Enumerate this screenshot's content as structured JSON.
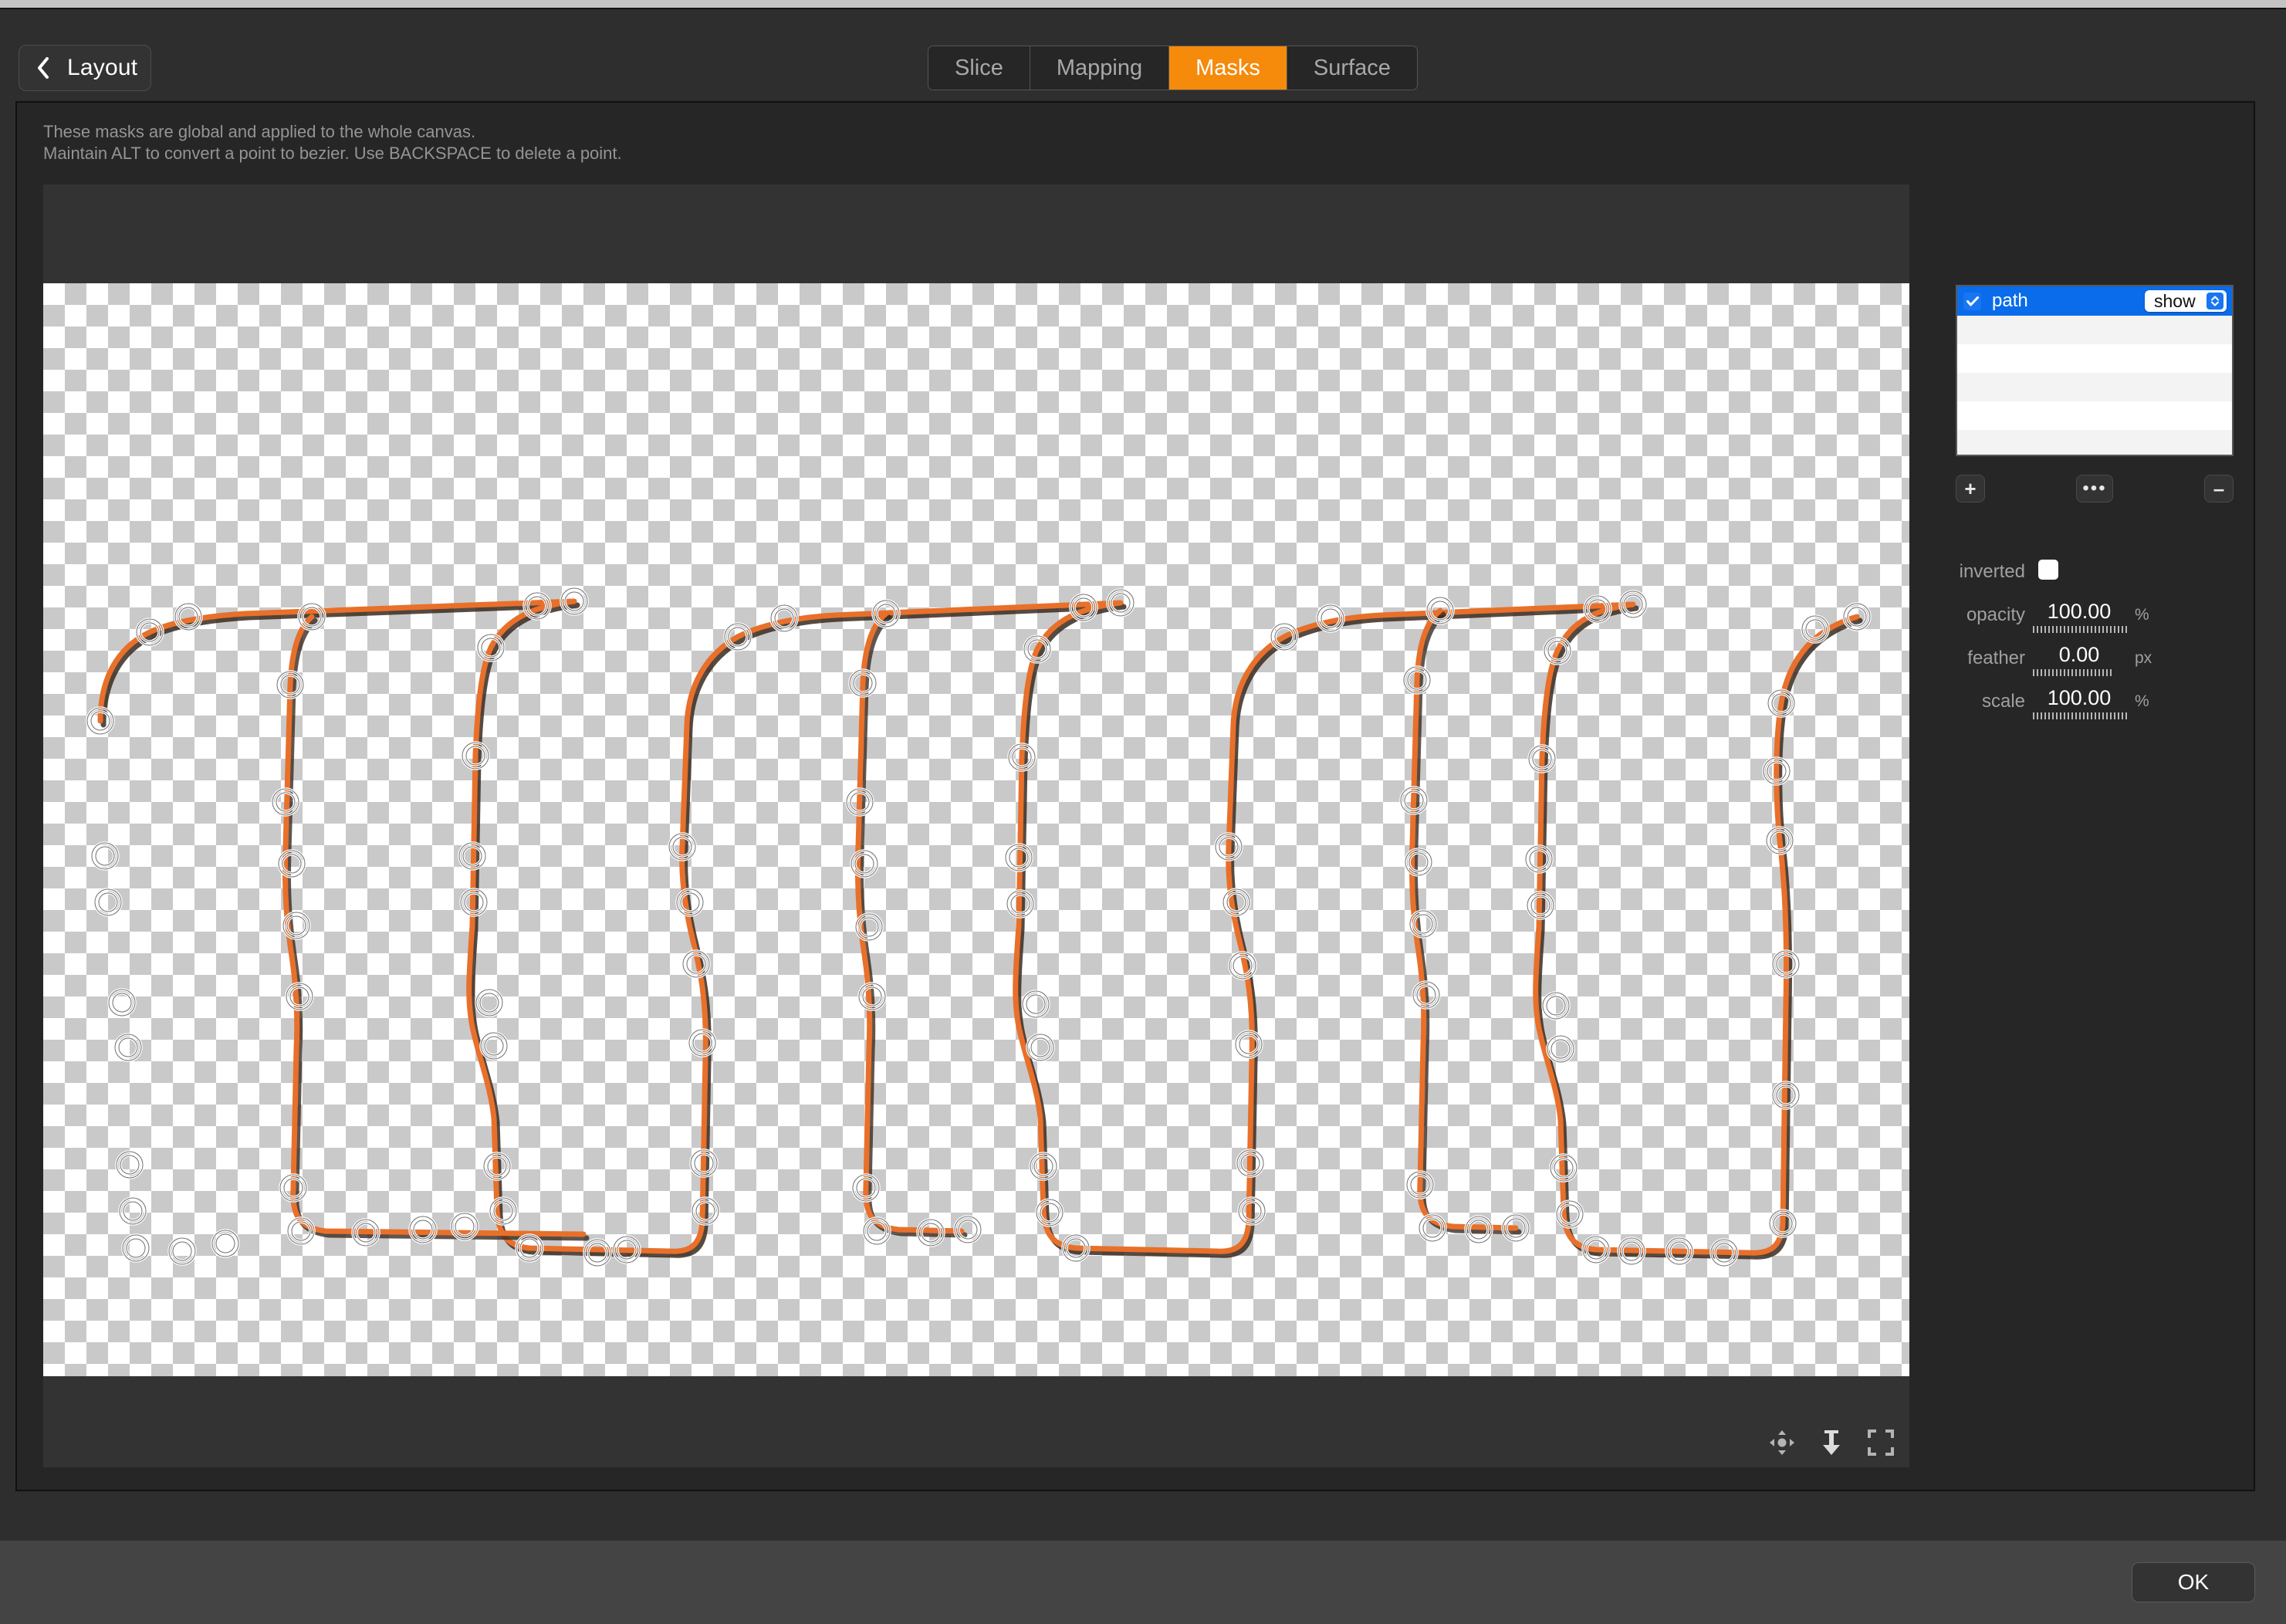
{
  "header": {
    "back_button": {
      "label": "Layout",
      "icon": "chevron-left-icon"
    },
    "tabs": [
      {
        "label": "Slice",
        "active": false
      },
      {
        "label": "Mapping",
        "active": false
      },
      {
        "label": "Masks",
        "active": true
      },
      {
        "label": "Surface",
        "active": false
      }
    ]
  },
  "main": {
    "hint_text": "These masks are global and applied to the whole canvas.\nMaintain ALT to convert a point to bezier. Use BACKSPACE to delete a point.",
    "canvas_tools": [
      {
        "name": "move-tool",
        "icon": "move-icon"
      },
      {
        "name": "fit-height-tool",
        "icon": "arrow-down-icon"
      },
      {
        "name": "fit-frame-tool",
        "icon": "fit-frame-icon"
      }
    ]
  },
  "sidebar": {
    "list": {
      "rows": [
        {
          "name": "path",
          "checked": true,
          "mode": "show",
          "selected": true
        },
        {
          "name": "",
          "checked": false,
          "mode": "",
          "selected": false
        },
        {
          "name": "",
          "checked": false,
          "mode": "",
          "selected": false
        },
        {
          "name": "",
          "checked": false,
          "mode": "",
          "selected": false
        },
        {
          "name": "",
          "checked": false,
          "mode": "",
          "selected": false
        },
        {
          "name": "",
          "checked": false,
          "mode": "",
          "selected": false
        }
      ]
    },
    "buttons": {
      "add": "+",
      "more": "•••",
      "remove": "–"
    },
    "properties": [
      {
        "label": "inverted",
        "type": "checkbox",
        "value": false,
        "unit": ""
      },
      {
        "label": "opacity",
        "type": "number",
        "value": "100.00",
        "unit": "%"
      },
      {
        "label": "feather",
        "type": "number",
        "value": "0.00",
        "unit": "px"
      },
      {
        "label": "scale",
        "type": "number",
        "value": "100.00",
        "unit": "%"
      }
    ]
  },
  "footer": {
    "ok_label": "OK"
  },
  "colors": {
    "accent_orange": "#f58a0b",
    "selection_blue": "#0a6ceb",
    "path_stroke": "#e8702a",
    "panel_bg": "#262626",
    "window_bg": "#2e2e2e",
    "footer_bg": "#444444"
  }
}
